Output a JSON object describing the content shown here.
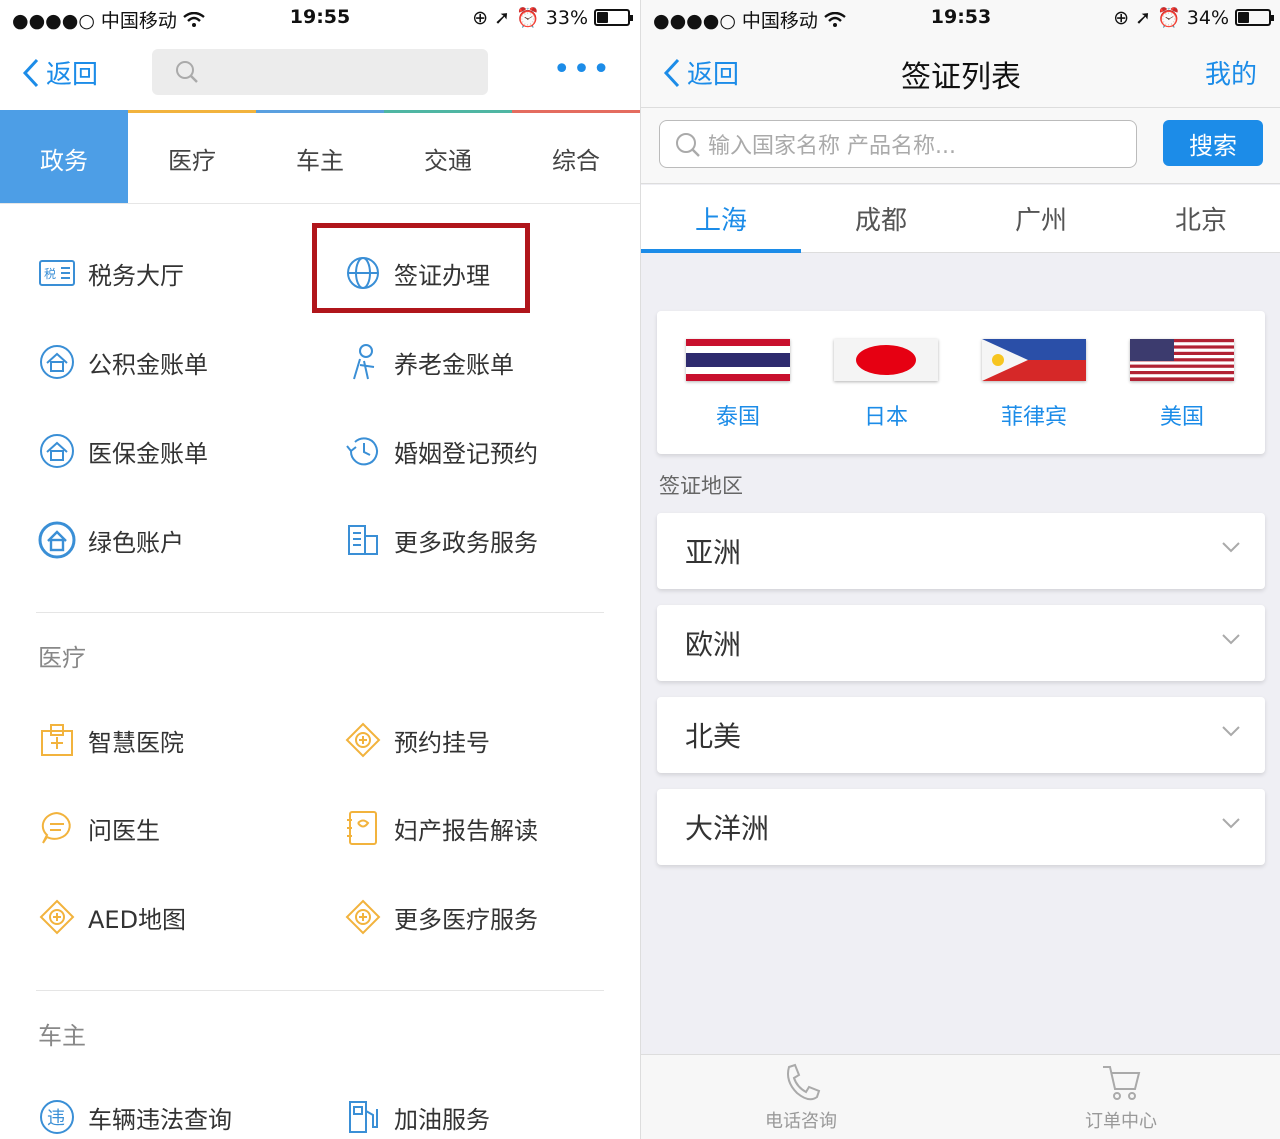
{
  "left": {
    "status": {
      "carrier": "●●●●○ 中国移动",
      "time": "19:55",
      "battery": "33%",
      "battery_level": 0.33
    },
    "nav": {
      "back": "返回",
      "more": "•••"
    },
    "tabs": [
      {
        "label": "政务"
      },
      {
        "label": "医疗"
      },
      {
        "label": "车主"
      },
      {
        "label": "交通"
      },
      {
        "label": "综合"
      }
    ],
    "gov_items": [
      {
        "label": "税务大厅"
      },
      {
        "label": "签证办理"
      },
      {
        "label": "公积金账单"
      },
      {
        "label": "养老金账单"
      },
      {
        "label": "医保金账单"
      },
      {
        "label": "婚姻登记预约"
      },
      {
        "label": "绿色账户"
      },
      {
        "label": "更多政务服务"
      }
    ],
    "medical": {
      "title": "医疗",
      "items": [
        {
          "label": "智慧医院"
        },
        {
          "label": "预约挂号"
        },
        {
          "label": "问医生"
        },
        {
          "label": "妇产报告解读"
        },
        {
          "label": "AED地图"
        },
        {
          "label": "更多医疗服务"
        }
      ]
    },
    "car": {
      "title": "车主",
      "items": [
        {
          "label": "车辆违法查询"
        },
        {
          "label": "加油服务"
        }
      ]
    },
    "icon_badge": {
      "tax": "税",
      "violation": "违"
    }
  },
  "right": {
    "status": {
      "carrier": "●●●●○ 中国移动",
      "time": "19:53",
      "battery": "34%",
      "battery_level": 0.34
    },
    "nav": {
      "back": "返回",
      "title": "签证列表",
      "mine": "我的"
    },
    "search": {
      "placeholder": "输入国家名称 产品名称...",
      "button": "搜索"
    },
    "cities": [
      {
        "label": "上海"
      },
      {
        "label": "成都"
      },
      {
        "label": "广州"
      },
      {
        "label": "北京"
      }
    ],
    "countries": [
      {
        "label": "泰国",
        "flag": "thailand-flag-icon"
      },
      {
        "label": "日本",
        "flag": "japan-flag-icon"
      },
      {
        "label": "菲律宾",
        "flag": "philippines-flag-icon"
      },
      {
        "label": "美国",
        "flag": "usa-flag-icon"
      }
    ],
    "region_label": "签证地区",
    "regions": [
      {
        "label": "亚洲"
      },
      {
        "label": "欧洲"
      },
      {
        "label": "北美"
      },
      {
        "label": "大洋洲"
      }
    ],
    "bottom": [
      {
        "label": "电话咨询",
        "icon": "phone-icon"
      },
      {
        "label": "订单中心",
        "icon": "cart-icon"
      }
    ]
  },
  "colors": {
    "accent": "#1c8ce8",
    "tab_active": "#4d9ee6",
    "highlight": "#b0151b",
    "medical_icon": "#f2b33d"
  }
}
